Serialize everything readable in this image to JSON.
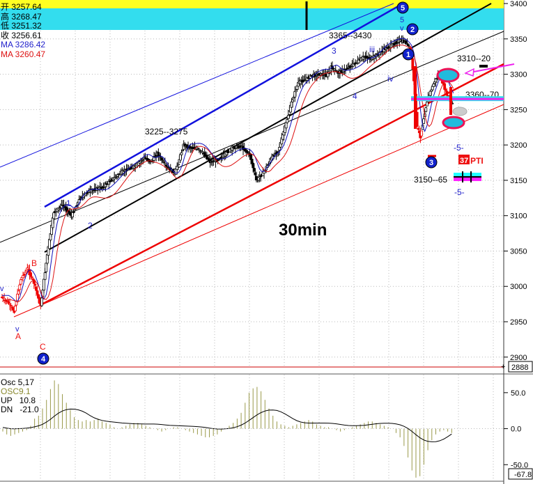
{
  "header": {
    "ohlc": [
      {
        "label": "开",
        "value": "3257.64",
        "color": "#000000"
      },
      {
        "label": "高",
        "value": "3268.47",
        "color": "#000000"
      },
      {
        "label": "低",
        "value": "3251.32",
        "color": "#000000"
      },
      {
        "label": "收",
        "value": "3256.61",
        "color": "#000000"
      },
      {
        "label": "MA",
        "value": "3286.42",
        "color": "#2222cc"
      },
      {
        "label": "MA",
        "value": "3260.47",
        "color": "#dd1111"
      }
    ]
  },
  "title": "30min",
  "colors": {
    "band_fill": "#33ddee",
    "band_top": "#ffff22",
    "blue_channel": "#1111dd",
    "black_line": "#000000",
    "red_line": "#ee0000",
    "ma_blue": "#1111bb",
    "ma_red": "#dd1111",
    "candle": "#000000",
    "candle_red": "#ee0000",
    "osc_bar": "#99994a",
    "osc_line": "#000000",
    "ellipse": "#ee1155",
    "ellipse_fill": "#22bbdd",
    "magenta": "#ee22ee",
    "grid": "#b8b8b8",
    "panel_border": "#cc0000"
  },
  "annotations": {
    "range_3365_3430": "3365--3430",
    "range_3225_3275": "3225--3275",
    "range_3310_20": "3310--20",
    "range_3360_70": "3360--70",
    "range_3150_65": "3150--65",
    "minus5_a": "-5-",
    "minus5_b": "-5-",
    "pti_box": "37",
    "pti_text": "PTI"
  },
  "waves": {
    "w5_circle": "5",
    "w2_circle": "2",
    "w1_circle": "1",
    "w3_circle": "3",
    "w4_circle": "4",
    "small_5": "5",
    "small_v": "v",
    "label_3": "3",
    "label_4": "4",
    "label_iii": "iii",
    "label_iv": "iv",
    "label_1": "1",
    "label_2": "2",
    "A": "A",
    "B": "B",
    "C": "C",
    "v_left": "v",
    "v_low": "v"
  },
  "oscillator": {
    "name": "Osc 5,17",
    "osc_name": "OSC9.1",
    "up_label": "UP",
    "up_value": "10.8",
    "dn_label": "DN",
    "dn_value": "-21.0"
  },
  "chart_data": {
    "type": "candlestick",
    "timeframe": "30min",
    "price_axis": {
      "ylim": [
        2885,
        3405
      ],
      "ticks": [
        "3400",
        "3350",
        "3300",
        "3250",
        "3200",
        "3150",
        "3100",
        "3050",
        "3000",
        "2950",
        "2900"
      ],
      "current_label": "2888"
    },
    "osc_axis": {
      "ylim": [
        -72,
        75
      ],
      "ticks": [
        "50.0",
        "0.0",
        "-50.0"
      ],
      "current_label": "-67.8"
    },
    "price_shape": [
      [
        0,
        2985
      ],
      [
        6,
        2978
      ],
      [
        12,
        2965
      ],
      [
        18,
        3010
      ],
      [
        24,
        3025
      ],
      [
        30,
        3005
      ],
      [
        36,
        2972
      ],
      [
        42,
        3045
      ],
      [
        48,
        3105
      ],
      [
        56,
        3115
      ],
      [
        64,
        3100
      ],
      [
        72,
        3125
      ],
      [
        80,
        3135
      ],
      [
        92,
        3140
      ],
      [
        100,
        3150
      ],
      [
        108,
        3160
      ],
      [
        114,
        3165
      ],
      [
        122,
        3170
      ],
      [
        130,
        3182
      ],
      [
        136,
        3176
      ],
      [
        142,
        3188
      ],
      [
        150,
        3170
      ],
      [
        158,
        3160
      ],
      [
        162,
        3180
      ],
      [
        166,
        3200
      ],
      [
        172,
        3196
      ],
      [
        178,
        3195
      ],
      [
        184,
        3188
      ],
      [
        190,
        3176
      ],
      [
        196,
        3178
      ],
      [
        202,
        3185
      ],
      [
        210,
        3196
      ],
      [
        218,
        3198
      ],
      [
        226,
        3186
      ],
      [
        232,
        3150
      ],
      [
        238,
        3160
      ],
      [
        246,
        3182
      ],
      [
        252,
        3192
      ],
      [
        258,
        3225
      ],
      [
        264,
        3260
      ],
      [
        270,
        3288
      ],
      [
        276,
        3292
      ],
      [
        282,
        3298
      ],
      [
        290,
        3300
      ],
      [
        296,
        3298
      ],
      [
        300,
        3310
      ],
      [
        306,
        3302
      ],
      [
        312,
        3306
      ],
      [
        318,
        3312
      ],
      [
        324,
        3318
      ],
      [
        330,
        3325
      ],
      [
        336,
        3322
      ],
      [
        342,
        3328
      ],
      [
        348,
        3335
      ],
      [
        354,
        3340
      ],
      [
        362,
        3348
      ],
      [
        368,
        3345
      ],
      [
        372,
        3335
      ],
      [
        374,
        3308
      ],
      [
        376,
        3270
      ],
      [
        378,
        3225
      ],
      [
        381,
        3212
      ],
      [
        384,
        3238
      ],
      [
        387,
        3262
      ],
      [
        390,
        3275
      ],
      [
        394,
        3290
      ],
      [
        398,
        3300
      ],
      [
        402,
        3285
      ],
      [
        406,
        3266
      ],
      [
        410,
        3258
      ]
    ],
    "moving_averages": [
      {
        "name": "MA",
        "value": 3286.42,
        "color": "#1111bb"
      },
      {
        "name": "MA",
        "value": 3260.47,
        "color": "#dd1111"
      }
    ],
    "annotation_levels": [
      {
        "text": "3365--3430",
        "price": 3360
      },
      {
        "text": "3225--3275",
        "price": 3222
      },
      {
        "text": "3310--20",
        "price": 3325
      },
      {
        "text": "3360--70",
        "price": 3270
      },
      {
        "text": "3150--65",
        "price": 3148
      }
    ],
    "reference_level": 3265,
    "osc_values": [
      -4,
      -8,
      -10,
      -8,
      -6,
      -4,
      -2,
      4,
      14,
      18,
      28,
      40,
      55,
      67,
      62,
      48,
      36,
      26,
      16,
      12,
      10,
      12,
      10,
      12,
      14,
      10,
      8,
      6,
      2,
      0,
      2,
      4,
      6,
      8,
      8,
      6,
      4,
      2,
      0,
      -2,
      -4,
      -2,
      0,
      2,
      2,
      0,
      -2,
      -4,
      -6,
      -8,
      -10,
      -12,
      -12,
      -10,
      -8,
      -4,
      0,
      4,
      8,
      14,
      22,
      36,
      50,
      56,
      58,
      52,
      40,
      28,
      18,
      10,
      6,
      4,
      2,
      4,
      6,
      8,
      10,
      12,
      10,
      6,
      4,
      2,
      2,
      0,
      -2,
      -4,
      -2,
      0,
      2,
      4,
      6,
      8,
      10,
      10,
      8,
      6,
      4,
      2,
      0,
      -6,
      -12,
      -24,
      -40,
      -58,
      -68,
      -66,
      -50,
      -30,
      -16,
      -8,
      -4,
      -2,
      -4,
      -6
    ]
  }
}
